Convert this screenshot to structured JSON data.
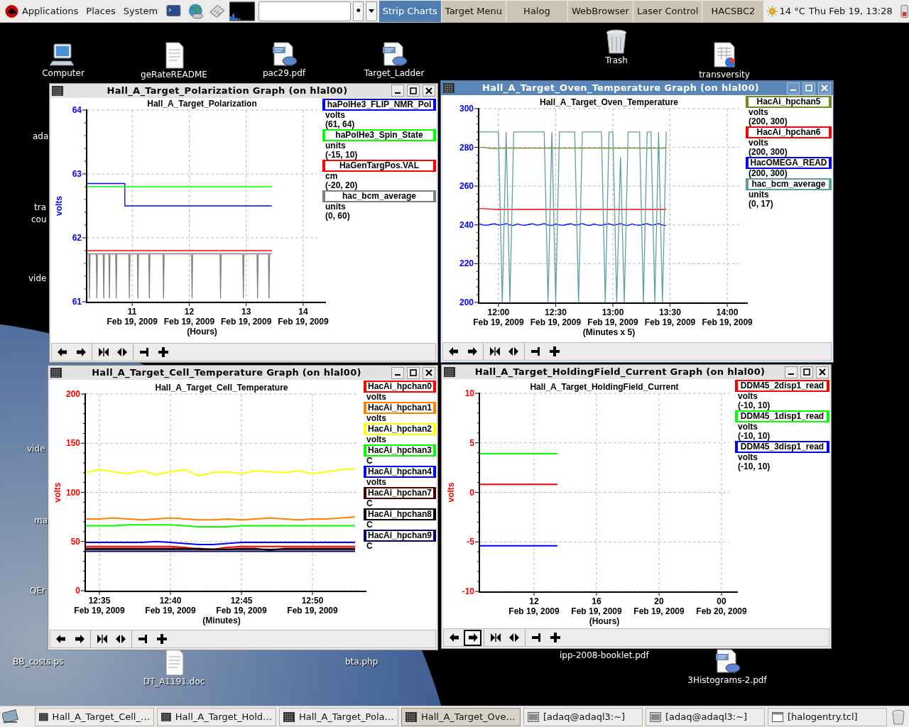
{
  "top_panel": {
    "menus": [
      "Applications",
      "Places",
      "System"
    ],
    "entry_button": "•",
    "tasks": [
      {
        "label": "Strip Charts",
        "selected": true
      },
      {
        "label": "Target Menu",
        "selected": false
      },
      {
        "label": "Halog",
        "selected": false
      },
      {
        "label": "WebBrowser",
        "selected": false
      },
      {
        "label": "Laser Control",
        "selected": false
      },
      {
        "label": "HACSBC2",
        "selected": false
      }
    ],
    "weather": "14 °C",
    "clock": "Thu Feb 19, 13:28"
  },
  "desktop_icons": [
    {
      "kind": "computer",
      "label": "Computer"
    },
    {
      "kind": "document",
      "label": "geRateREADME"
    },
    {
      "kind": "pdf",
      "label": "pac29.pdf"
    },
    {
      "kind": "pdf",
      "label": "Target_Ladder"
    },
    {
      "kind": "trash",
      "label": "Trash"
    },
    {
      "kind": "spreadsheet",
      "label": "transversity"
    },
    {
      "kind": "text",
      "label": "ada"
    },
    {
      "kind": "text",
      "label": "tra"
    },
    {
      "kind": "text",
      "label": "cou"
    },
    {
      "kind": "text",
      "label": "vide"
    },
    {
      "kind": "text",
      "label": "vide"
    },
    {
      "kind": "text",
      "label": "ma"
    },
    {
      "kind": "text",
      "label": "QEr"
    },
    {
      "kind": "text",
      "label": "BB_costs.ps"
    },
    {
      "kind": "document",
      "label": "DT_A1191.doc"
    },
    {
      "kind": "text",
      "label": "bta.php"
    },
    {
      "kind": "text",
      "label": "ipp-2008-booklet.pdf"
    },
    {
      "kind": "pdf",
      "label": "3Histograms-2.pdf"
    }
  ],
  "windows": [
    {
      "title": "Hall_A_Target_Polarization Graph (on hlal00)",
      "active": false,
      "chart_data": {
        "type": "line",
        "title": "Hall_A_Target_Polarization",
        "xlabel": "(Hours)",
        "ylabel": "volts",
        "grid": true,
        "x": [
          10.2,
          10.24,
          10.25,
          10.26,
          10.37,
          10.38,
          10.39,
          10.49,
          10.5,
          10.51,
          10.59,
          10.6,
          10.61,
          10.71,
          10.72,
          10.73,
          10.87,
          10.87,
          10.94,
          10.95,
          10.96,
          11.09,
          11.1,
          11.11,
          11.29,
          11.3,
          11.31,
          11.54,
          11.55,
          11.56,
          12.04,
          12.05,
          12.06,
          12.54,
          12.55,
          12.56,
          12.94,
          12.95,
          12.96,
          13.19,
          13.2,
          13.21,
          13.39,
          13.4,
          13.41,
          13.45
        ],
        "xlim": [
          10.2,
          14.25
        ],
        "ylim": [
          61,
          64
        ],
        "xticks": [
          11,
          12,
          13,
          14
        ],
        "yticks": [
          61,
          62,
          63,
          64
        ],
        "series": [
          {
            "name": "haPolHe3_FLIP_NMR_Pol",
            "color": "#0000ff",
            "values": [
              62.85,
              62.85,
              62.85,
              62.85,
              62.85,
              62.85,
              62.85,
              62.85,
              62.85,
              62.85,
              62.85,
              62.85,
              62.85,
              62.85,
              62.85,
              62.85,
              62.85,
              62.5,
              62.5,
              62.5,
              62.5,
              62.5,
              62.5,
              62.5,
              62.5,
              62.5,
              62.5,
              62.5,
              62.5,
              62.5,
              62.5,
              62.5,
              62.5,
              62.5,
              62.5,
              62.5,
              62.5,
              62.5,
              62.5,
              62.5,
              62.5,
              62.5,
              62.5,
              62.5,
              62.5,
              62.5
            ]
          },
          {
            "name": "haPolHe3_Spin_State",
            "color": "#00ff00",
            "values": [
              62.8,
              62.8,
              62.8,
              62.8,
              62.8,
              62.8,
              62.8,
              62.8,
              62.8,
              62.8,
              62.8,
              62.8,
              62.8,
              62.8,
              62.8,
              62.8,
              62.8,
              62.8,
              62.8,
              62.8,
              62.8,
              62.8,
              62.8,
              62.8,
              62.8,
              62.8,
              62.8,
              62.8,
              62.8,
              62.8,
              62.8,
              62.8,
              62.8,
              62.8,
              62.8,
              62.8,
              62.8,
              62.8,
              62.8,
              62.8,
              62.8,
              62.8,
              62.8,
              62.8,
              62.8,
              62.8
            ]
          },
          {
            "name": "HaGenTargPos.VAL",
            "color": "#ff0000",
            "values": [
              61.8,
              61.8,
              61.8,
              61.8,
              61.8,
              61.8,
              61.8,
              61.8,
              61.8,
              61.8,
              61.8,
              61.8,
              61.8,
              61.8,
              61.8,
              61.8,
              61.8,
              61.8,
              61.8,
              61.8,
              61.8,
              61.8,
              61.8,
              61.8,
              61.8,
              61.8,
              61.8,
              61.8,
              61.8,
              61.8,
              61.8,
              61.8,
              61.8,
              61.8,
              61.8,
              61.8,
              61.8,
              61.8,
              61.8,
              61.8,
              61.8,
              61.8,
              61.8,
              61.8,
              61.8,
              61.8
            ]
          },
          {
            "name": "hac_bcm_average",
            "color": "#808080",
            "values": [
              61.75,
              61.75,
              61.05,
              61.75,
              61.75,
              61.05,
              61.75,
              61.75,
              61.05,
              61.75,
              61.75,
              61.05,
              61.75,
              61.75,
              61.05,
              61.75,
              61.75,
              61.75,
              61.75,
              61.05,
              61.75,
              61.75,
              61.05,
              61.75,
              61.75,
              61.05,
              61.75,
              61.75,
              61.05,
              61.75,
              61.75,
              61.05,
              61.75,
              61.75,
              61.05,
              61.75,
              61.75,
              61.05,
              61.75,
              61.75,
              61.05,
              61.75,
              61.75,
              61.05,
              61.75,
              61.75
            ]
          }
        ]
      },
      "x_dates": [
        "Feb 19, 2009",
        "Feb 19, 2009",
        "Feb 19, 2009",
        "Feb 19, 2009"
      ],
      "legend": [
        {
          "unit": "volts",
          "range": "(61, 64)"
        },
        {
          "unit": "units",
          "range": "(-15, 10)"
        },
        {
          "unit": "cm",
          "range": "(-20, 20)"
        },
        {
          "unit": "units",
          "range": "(0, 60)"
        }
      ],
      "toolbar": [
        {
          "kind": "left",
          "selected": false
        },
        {
          "kind": "right",
          "selected": false
        },
        {
          "kind": "squeeze",
          "selected": false
        },
        {
          "kind": "stretch",
          "selected": false
        },
        {
          "kind": "end",
          "selected": false
        },
        {
          "kind": "plus",
          "selected": false
        }
      ]
    },
    {
      "title": "Hall_A_Target_Oven_Temperature Graph (on hlal00)",
      "active": true,
      "chart_data": {
        "type": "line",
        "title": "Hall_A_Target_Oven_Temperature",
        "xlabel": "(Minutes x 5)",
        "grid": true,
        "categories": [
          null,
          null,
          null,
          null,
          null,
          "12:00",
          null,
          null,
          null,
          null,
          null,
          null,
          null,
          null,
          null,
          null,
          null,
          null,
          null,
          null,
          "12:30",
          null,
          null,
          null,
          null,
          null,
          null,
          null,
          null,
          null,
          null,
          null,
          null,
          null,
          null,
          "13:00",
          null,
          null,
          null,
          null,
          null,
          null,
          null,
          null,
          null,
          null,
          null,
          null,
          null,
          null,
          "13:30",
          null,
          null,
          null,
          null,
          null,
          null,
          null,
          null,
          null,
          null,
          null,
          null,
          null,
          null,
          "14:00"
        ],
        "ylim": [
          200,
          300
        ],
        "yticks": [
          200,
          220,
          240,
          260,
          280,
          300
        ],
        "series": [
          {
            "name": "HacAi_hpchan5",
            "color": "#6b8e23",
            "values": [
              280,
              280,
              279.8,
              279.5,
              279.5,
              279.4,
              279.6,
              279.6,
              279.6,
              279.6,
              279.6,
              279.6,
              279.6,
              279.6,
              279.6,
              279.6,
              279.6,
              279.6,
              279.6,
              279.6,
              279.6,
              279.6,
              279.6,
              279.6,
              279.6,
              279.6,
              279.6,
              279.6,
              279.6,
              279.6,
              279.6,
              279.6,
              279.6,
              279.6,
              279.6,
              279.6,
              279.6,
              279.6,
              279.6,
              279.6,
              279.6,
              279.6,
              279.6,
              279.6,
              279.6,
              279.6,
              279.6,
              279.6,
              279.6,
              279.6,
              null,
              null,
              null,
              null,
              null,
              null,
              null,
              null,
              null,
              null,
              null,
              null,
              null,
              null,
              null,
              null
            ]
          },
          {
            "name": "HacAi_hpchan6",
            "color": "#ff0000",
            "values": [
              248.4,
              248.4,
              248.3,
              248.2,
              248,
              248,
              248,
              248,
              248,
              248,
              248,
              248,
              248,
              248,
              248,
              248,
              248,
              248,
              248,
              248,
              248,
              248,
              248,
              248,
              248,
              248,
              248,
              248,
              248,
              248,
              248,
              248,
              248,
              248,
              248,
              248,
              248,
              248,
              248,
              248,
              248,
              248,
              248,
              248,
              248,
              248,
              248,
              248,
              248,
              248,
              null,
              null,
              null,
              null,
              null,
              null,
              null,
              null,
              null,
              null,
              null,
              null,
              null,
              null,
              null,
              null
            ]
          },
          {
            "name": "HacOMEGA_READ",
            "color": "#0000ff",
            "values": [
              240.5,
              240,
              239.8,
              240.3,
              240.6,
              239.9,
              240.2,
              240.7,
              240,
              239.7,
              240.5,
              240,
              239.8,
              240.3,
              240.6,
              239.9,
              240.2,
              240.7,
              240,
              239.7,
              240.5,
              240,
              239.8,
              240.3,
              240.6,
              239.9,
              240.2,
              240.7,
              240,
              239.7,
              240.5,
              240,
              239.8,
              240.3,
              240.6,
              239.9,
              240.2,
              240.7,
              240,
              239.7,
              240.5,
              240,
              239.8,
              240.3,
              240.6,
              239.9,
              240.2,
              240.7,
              240,
              239.7,
              null,
              null,
              null,
              null,
              null,
              null,
              null,
              null,
              null,
              null,
              null,
              null,
              null,
              null,
              null,
              null
            ]
          },
          {
            "name": "hac_bcm_average",
            "color": "#5f9ea0",
            "values": [
              288,
              288,
              288,
              288,
              288,
              288,
              200,
              288,
              200,
              288,
              288,
              288,
              288,
              288,
              288,
              288,
              288,
              288,
              200,
              288,
              200,
              288,
              288,
              288,
              288,
              288,
              200,
              288,
              288,
              288,
              288,
              288,
              288,
              200,
              288,
              288,
              200,
              275,
              200,
              288,
              288,
              288,
              288,
              200,
              288,
              288,
              200,
              288,
              200,
              288,
              null,
              null,
              null,
              null,
              null,
              null,
              null,
              null,
              null,
              null,
              null,
              null,
              null,
              null,
              null,
              null
            ]
          }
        ]
      },
      "x_dates": [
        "Feb 19, 2009",
        "Feb 19, 2009",
        "Feb 19, 2009",
        "Feb 19, 2009",
        "Feb 19, 2009"
      ],
      "legend": [
        {
          "unit": "volts",
          "range": "(200, 300)"
        },
        {
          "unit": "volts",
          "range": "(200, 300)"
        },
        {
          "range": "(200, 300)"
        },
        {
          "unit": "units",
          "range": "(0, 17)"
        }
      ],
      "toolbar": [
        {
          "kind": "left",
          "selected": false
        },
        {
          "kind": "right",
          "selected": false
        },
        {
          "kind": "squeeze",
          "selected": false
        },
        {
          "kind": "stretch",
          "selected": false
        },
        {
          "kind": "end",
          "selected": false
        },
        {
          "kind": "plus",
          "selected": false
        }
      ]
    },
    {
      "title": "Hall_A_Target_Cell_Temperature Graph (on hlal00)",
      "active": false,
      "chart_data": {
        "type": "line",
        "title": "Hall_A_Target_Cell_Temperature",
        "xlabel": "(Minutes)",
        "ylabel": "volts",
        "grid": true,
        "categories": [
          null,
          "12:35",
          null,
          null,
          null,
          null,
          "12:40",
          null,
          null,
          null,
          null,
          "12:45",
          null,
          null,
          null,
          null,
          "12:50",
          null,
          null,
          null
        ],
        "ylim": [
          0,
          200
        ],
        "yticks": [
          0,
          50,
          100,
          150,
          200
        ],
        "series": [
          {
            "name": "HacAi_hpchan0",
            "color": "#ff0000",
            "values": [
              45,
              45,
              45,
              45,
              45,
              45,
              45,
              44,
              42,
              42,
              44,
              45,
              45,
              45,
              45,
              45,
              45,
              45,
              45,
              45
            ]
          },
          {
            "name": "HacAi_hpchan1",
            "color": "#ff8000",
            "values": [
              73,
              73,
              74,
              73,
              72,
              73,
              74,
              73,
              72,
              72,
              73,
              72,
              73,
              74,
              73,
              72,
              73,
              73,
              74,
              75
            ]
          },
          {
            "name": "HacAi_hpchan2",
            "color": "#ffff00",
            "values": [
              120,
              123,
              121,
              119,
              122,
              118,
              121,
              123,
              117,
              120,
              121,
              119,
              122,
              121,
              120,
              122,
              119,
              121,
              123,
              124
            ]
          },
          {
            "name": "HacAi_hpchan3",
            "color": "#00ff00",
            "values": [
              66,
              66,
              66,
              67,
              67,
              67,
              67,
              66,
              65,
              65,
              65,
              66,
              66,
              66,
              66,
              66,
              66,
              66,
              66,
              66
            ]
          },
          {
            "name": "HacAi_hpchan4",
            "color": "#0000ff",
            "values": [
              49,
              49,
              49,
              49,
              49,
              50,
              49,
              48,
              47,
              47,
              48,
              49,
              49,
              49,
              49,
              49,
              49,
              49,
              49,
              49
            ]
          },
          {
            "name": "HacAi_hpchan7",
            "color": "#4b0000",
            "values": [
              43,
              43,
              43,
              43,
              43,
              43,
              43,
              43,
              43,
              42,
              42,
              43,
              43,
              41,
              43,
              43,
              43,
              43,
              43,
              43
            ]
          },
          {
            "name": "HacAi_hpchan8",
            "color": "#000000",
            "values": [
              42,
              42,
              42,
              42,
              42,
              42,
              42,
              42,
              42,
              42,
              42,
              42,
              42,
              42,
              42,
              42,
              42,
              42,
              42,
              42
            ]
          },
          {
            "name": "HacAi_hpchan9",
            "color": "#000066",
            "values": [
              40,
              40,
              40,
              40,
              40,
              40,
              40,
              40,
              40,
              40,
              40,
              40,
              40,
              40,
              40,
              40,
              40,
              40,
              40,
              40
            ]
          }
        ]
      },
      "x_dates": [
        "Feb 19, 2009",
        "Feb 19, 2009",
        "Feb 19, 2009",
        "Feb 19, 2009"
      ],
      "legend": [
        {
          "unit": "volts"
        },
        {
          "unit": "volts"
        },
        {
          "unit": "volts"
        },
        {
          "unit": "C"
        },
        {
          "unit": "volts"
        },
        {
          "unit": "C"
        },
        {
          "unit": "C"
        },
        {
          "unit": "C"
        }
      ],
      "toolbar": [
        {
          "kind": "left",
          "selected": false
        },
        {
          "kind": "right",
          "selected": false
        },
        {
          "kind": "squeeze",
          "selected": false
        },
        {
          "kind": "stretch",
          "selected": false
        },
        {
          "kind": "end",
          "selected": false
        },
        {
          "kind": "plus",
          "selected": false
        }
      ]
    },
    {
      "title": "Hall_A_Target_HoldingField_Current Graph (on hlal00)",
      "active": false,
      "chart_data": {
        "type": "line",
        "title": "Hall_A_Target_HoldingField_Current",
        "xlabel": "(Hours)",
        "ylabel": "volts",
        "grid": true,
        "categories": [
          null,
          null,
          null,
          null,
          null,
          null,
          null,
          "12",
          null,
          null,
          null,
          null,
          null,
          null,
          null,
          "16",
          null,
          null,
          null,
          null,
          null,
          null,
          null,
          "20",
          null,
          null,
          null,
          null,
          null,
          null,
          null,
          "00",
          null
        ],
        "ylim": [
          -10,
          10
        ],
        "yticks": [
          -10,
          -5,
          0,
          5,
          10
        ],
        "series": [
          {
            "name": "DDM45_2disp1_read",
            "color": "#ff0000",
            "values": [
              0.8,
              0.8,
              0.8,
              0.8,
              0.8,
              0.8,
              0.8,
              0.8,
              0.8,
              0.8,
              0.8,
              null,
              null,
              null,
              null,
              null,
              null,
              null,
              null,
              null,
              null,
              null,
              null,
              null,
              null,
              null,
              null,
              null,
              null,
              null,
              null,
              null,
              null
            ]
          },
          {
            "name": "DDM45_1disp1_read",
            "color": "#00ff00",
            "values": [
              3.9,
              3.9,
              3.9,
              3.9,
              3.9,
              3.9,
              3.9,
              3.9,
              3.9,
              3.9,
              3.9,
              null,
              null,
              null,
              null,
              null,
              null,
              null,
              null,
              null,
              null,
              null,
              null,
              null,
              null,
              null,
              null,
              null,
              null,
              null,
              null,
              null,
              null
            ]
          },
          {
            "name": "DDM45_3disp1_read",
            "color": "#0000ff",
            "values": [
              -5.4,
              -5.4,
              -5.4,
              -5.4,
              -5.4,
              -5.4,
              -5.4,
              -5.4,
              -5.4,
              -5.4,
              -5.4,
              null,
              null,
              null,
              null,
              null,
              null,
              null,
              null,
              null,
              null,
              null,
              null,
              null,
              null,
              null,
              null,
              null,
              null,
              null,
              null,
              null,
              null
            ]
          }
        ]
      },
      "x_dates": [
        "Feb 19, 2009",
        "Feb 19, 2009",
        "Feb 19, 2009",
        "Feb 20, 2009"
      ],
      "legend": [
        {
          "unit": "volts",
          "range": "(-10, 10)"
        },
        {
          "unit": "volts",
          "range": "(-10, 10)"
        },
        {
          "unit": "volts",
          "range": "(-10, 10)"
        }
      ],
      "toolbar": [
        {
          "kind": "left",
          "selected": false
        },
        {
          "kind": "right",
          "selected": true
        },
        {
          "kind": "squeeze",
          "selected": false
        },
        {
          "kind": "stretch",
          "selected": false
        },
        {
          "kind": "end",
          "selected": false
        },
        {
          "kind": "plus",
          "selected": false
        }
      ]
    }
  ],
  "taskbar": {
    "items": [
      {
        "kind": "graph",
        "label": "Hall_A_Target_Cell_…",
        "selected": false
      },
      {
        "kind": "graph",
        "label": "Hall_A_Target_Hold…",
        "selected": false
      },
      {
        "kind": "graph",
        "label": "Hall_A_Target_Pola…",
        "selected": false
      },
      {
        "kind": "graph",
        "label": "Hall_A_Target_Ove…",
        "selected": true
      },
      {
        "kind": "terminal",
        "label": "[adaq@adaql3:~]",
        "selected": false
      },
      {
        "kind": "terminal",
        "label": "[adaq@adaql3:~]",
        "selected": false
      },
      {
        "kind": "window",
        "label": "[halogentry.tcl]",
        "selected": false
      }
    ]
  }
}
